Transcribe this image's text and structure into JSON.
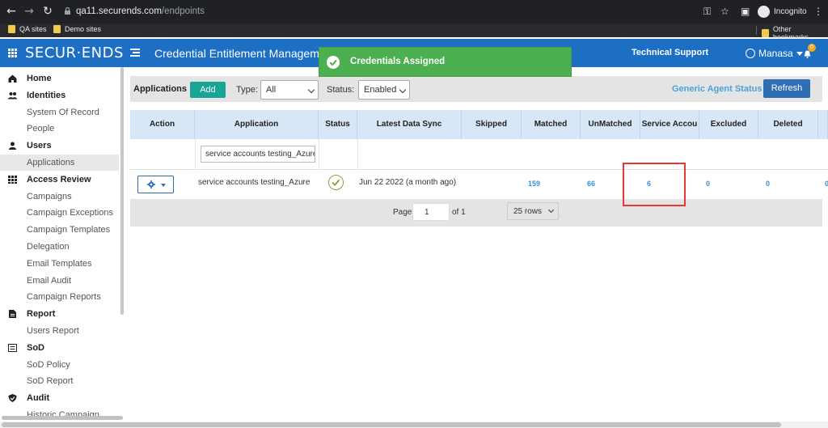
{
  "browser": {
    "url_host": "qa11.securends.com",
    "url_path": "/endpoints",
    "incognito_label": "Incognito",
    "bookmarks": [
      "QA sites",
      "Demo sites"
    ],
    "other_bookmarks": "Other bookmarks"
  },
  "header": {
    "logo": "SECUR·ENDS",
    "title": "Credential Entitlement Management",
    "tech_support": "Technical Support",
    "user": "Manasa",
    "notification_count": "0"
  },
  "toast": {
    "message": "Credentials Assigned",
    "color": "#4caf50"
  },
  "sidebar": {
    "items": [
      {
        "label": "Home",
        "type": "head",
        "icon": "home-icon"
      },
      {
        "label": "Identities",
        "type": "head",
        "icon": "users-icon"
      },
      {
        "label": "System Of Record",
        "type": "sub"
      },
      {
        "label": "People",
        "type": "sub"
      },
      {
        "label": "Users",
        "type": "head",
        "icon": "user-icon"
      },
      {
        "label": "Applications",
        "type": "sub",
        "active": true
      },
      {
        "label": "Access Review",
        "type": "head",
        "icon": "grid-icon"
      },
      {
        "label": "Campaigns",
        "type": "sub"
      },
      {
        "label": "Campaign Exceptions",
        "type": "sub"
      },
      {
        "label": "Campaign Templates",
        "type": "sub"
      },
      {
        "label": "Delegation",
        "type": "sub"
      },
      {
        "label": "Email Templates",
        "type": "sub"
      },
      {
        "label": "Email Audit",
        "type": "sub"
      },
      {
        "label": "Campaign Reports",
        "type": "sub"
      },
      {
        "label": "Report",
        "type": "head",
        "icon": "report-icon"
      },
      {
        "label": "Users Report",
        "type": "sub"
      },
      {
        "label": "SoD",
        "type": "head",
        "icon": "sod-icon"
      },
      {
        "label": "SoD Policy",
        "type": "sub"
      },
      {
        "label": "SoD Report",
        "type": "sub"
      },
      {
        "label": "Audit",
        "type": "head",
        "icon": "shield-icon"
      },
      {
        "label": "Historic Campaign",
        "type": "sub"
      }
    ]
  },
  "toolbar": {
    "title": "Applications",
    "add_label": "Add",
    "type_label": "Type:",
    "type_value": "All",
    "status_label": "Status:",
    "status_value": "Enabled",
    "agent_status_label": "Generic Agent Status",
    "refresh_label": "Refresh"
  },
  "table": {
    "columns": [
      "Action",
      "Application",
      "Status",
      "Latest Data Sync",
      "Skipped",
      "Matched",
      "UnMatched",
      "Service Accou",
      "Excluded",
      "Deleted",
      ""
    ],
    "filter_application": "service accounts testing_Azure",
    "row": {
      "application": "service accounts testing_Azure",
      "latest_sync": "Jun 22 2022 (a month ago)",
      "skipped": "",
      "matched": "159",
      "unmatched": "66",
      "service_accounts": "6",
      "excluded": "0",
      "deleted": "0",
      "extra": "0"
    }
  },
  "pager": {
    "page_label": "Page",
    "page_value": "1",
    "of_label": "of 1",
    "rows_value": "25 rows"
  }
}
